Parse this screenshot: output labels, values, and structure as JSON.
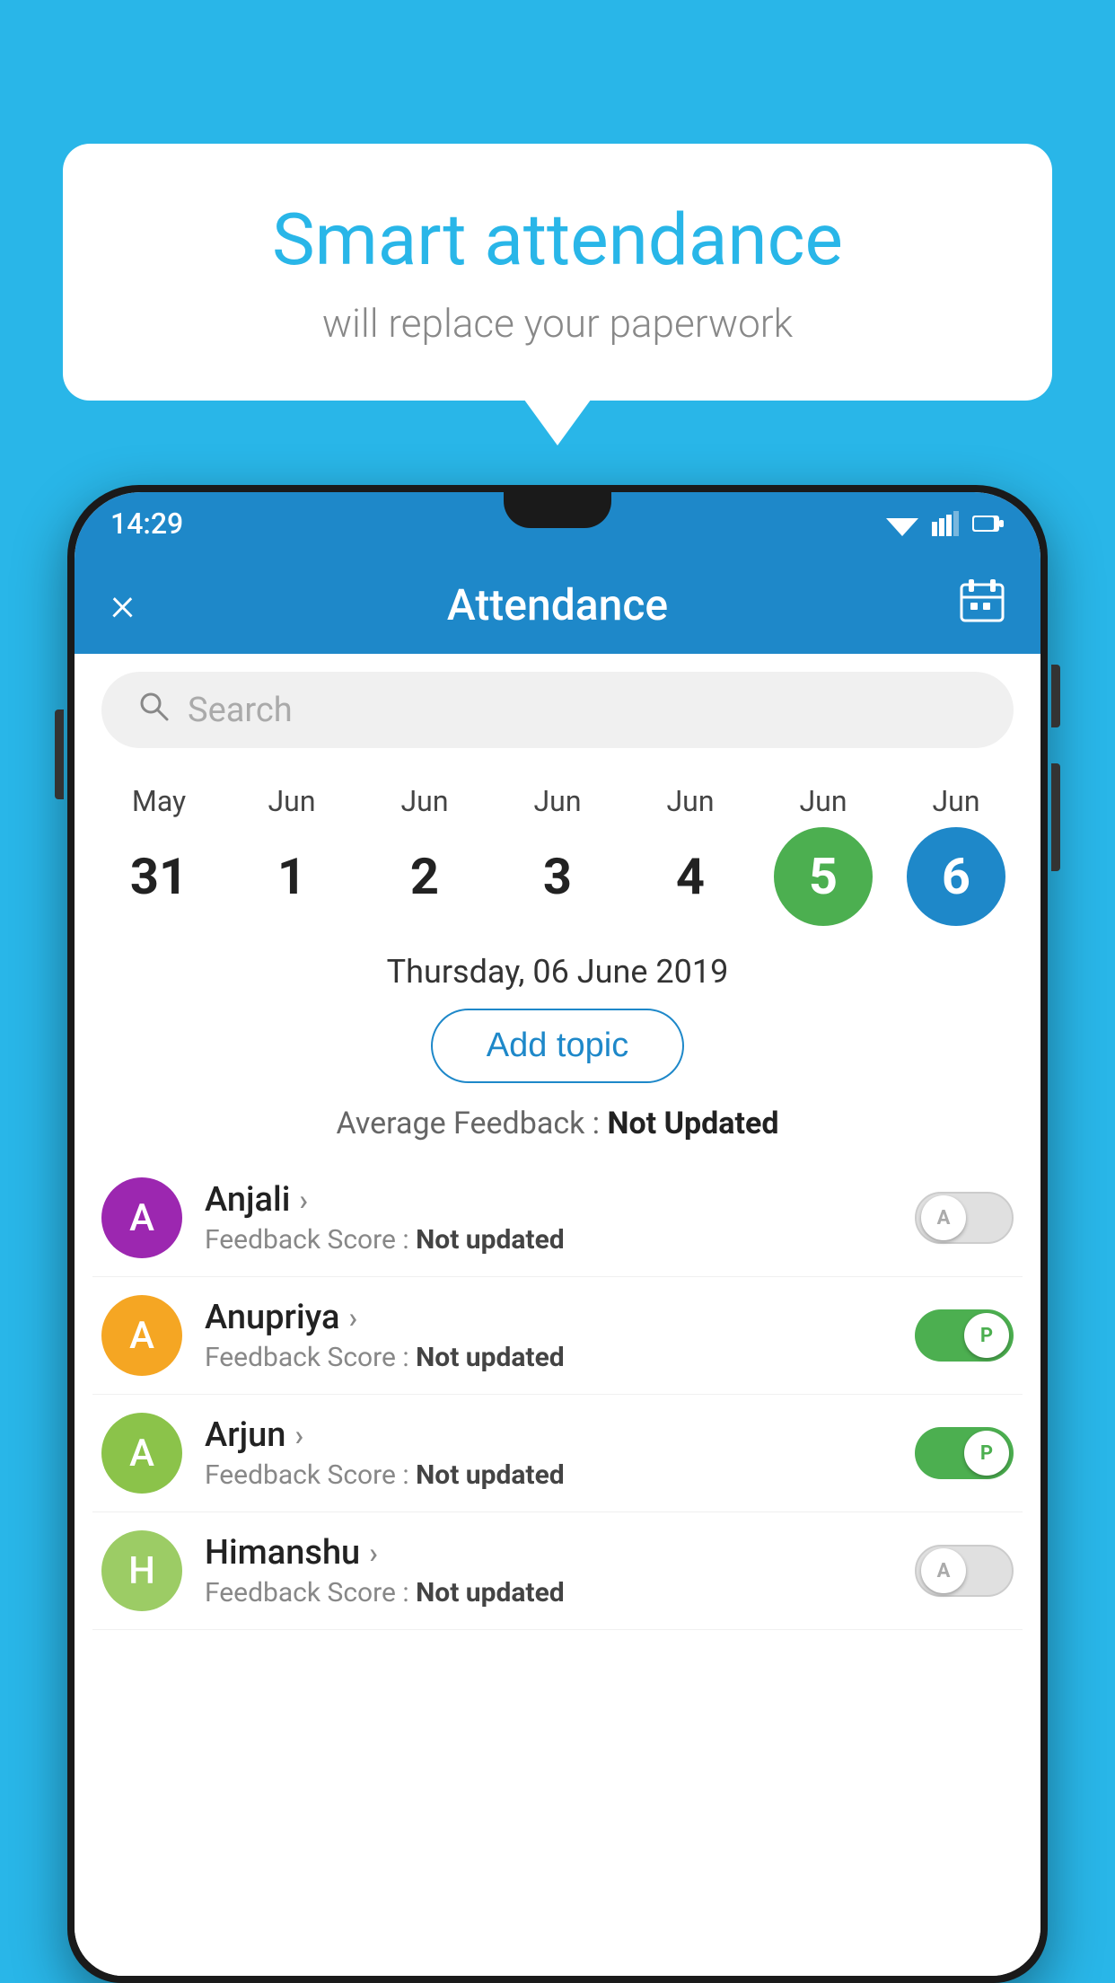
{
  "background_color": "#29b6e8",
  "speech_bubble": {
    "title": "Smart attendance",
    "subtitle": "will replace your paperwork"
  },
  "status_bar": {
    "time": "14:29"
  },
  "app_bar": {
    "title": "Attendance",
    "close_label": "×",
    "calendar_label": "📅"
  },
  "search": {
    "placeholder": "Search"
  },
  "date_strip": {
    "dates": [
      {
        "month": "May",
        "day": "31",
        "state": "normal"
      },
      {
        "month": "Jun",
        "day": "1",
        "state": "normal"
      },
      {
        "month": "Jun",
        "day": "2",
        "state": "normal"
      },
      {
        "month": "Jun",
        "day": "3",
        "state": "normal"
      },
      {
        "month": "Jun",
        "day": "4",
        "state": "normal"
      },
      {
        "month": "Jun",
        "day": "5",
        "state": "today"
      },
      {
        "month": "Jun",
        "day": "6",
        "state": "selected"
      }
    ]
  },
  "selected_date": "Thursday, 06 June 2019",
  "add_topic_label": "Add topic",
  "avg_feedback_label": "Average Feedback :",
  "avg_feedback_value": "Not Updated",
  "students": [
    {
      "name": "Anjali",
      "avatar_letter": "A",
      "avatar_color": "#9c27b0",
      "feedback_label": "Feedback Score :",
      "feedback_value": "Not updated",
      "toggle_state": "off",
      "toggle_letter": "A"
    },
    {
      "name": "Anupriya",
      "avatar_letter": "A",
      "avatar_color": "#f5a623",
      "feedback_label": "Feedback Score :",
      "feedback_value": "Not updated",
      "toggle_state": "on",
      "toggle_letter": "P"
    },
    {
      "name": "Arjun",
      "avatar_letter": "A",
      "avatar_color": "#8bc34a",
      "feedback_label": "Feedback Score :",
      "feedback_value": "Not updated",
      "toggle_state": "on",
      "toggle_letter": "P"
    },
    {
      "name": "Himanshu",
      "avatar_letter": "H",
      "avatar_color": "#9ccc65",
      "feedback_label": "Feedback Score :",
      "feedback_value": "Not updated",
      "toggle_state": "off",
      "toggle_letter": "A"
    }
  ]
}
